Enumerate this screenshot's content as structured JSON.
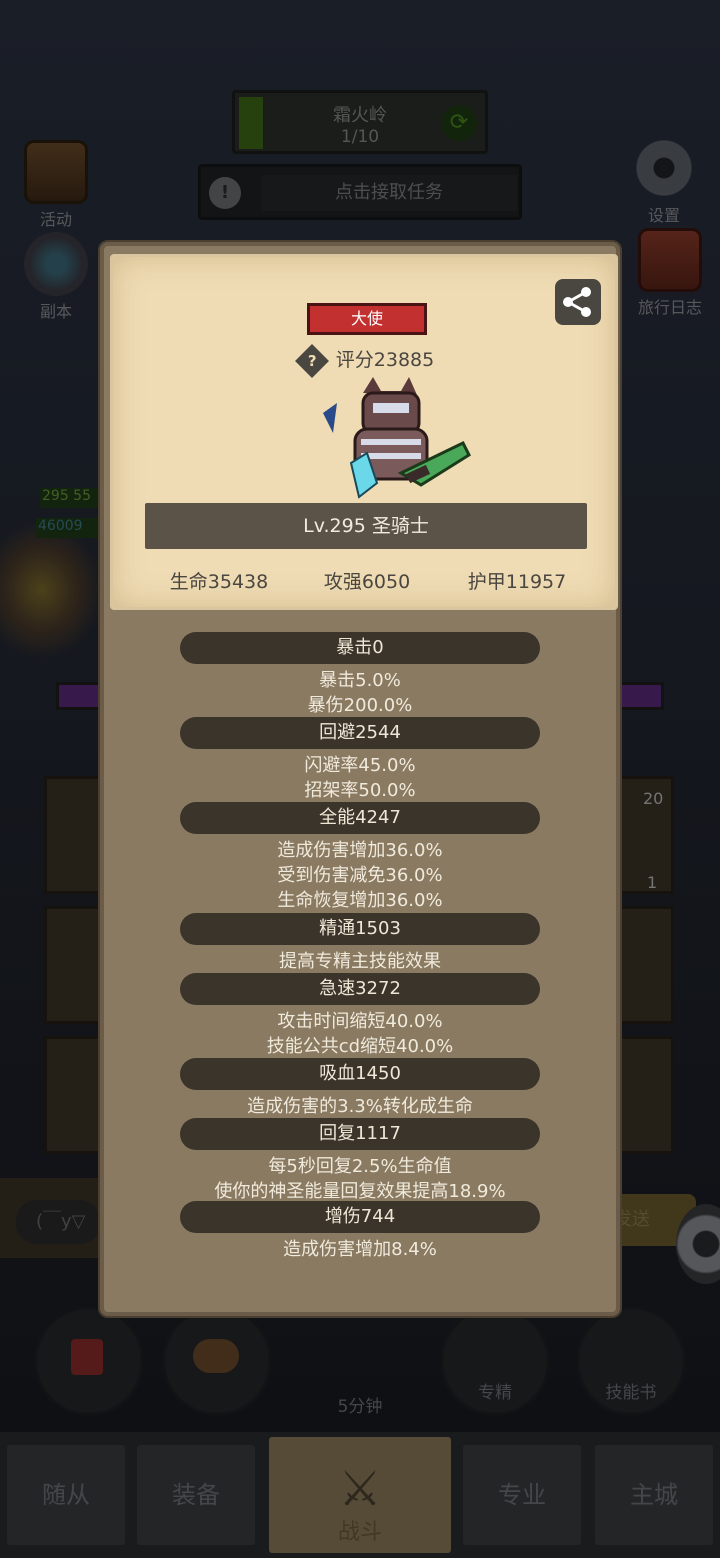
{
  "stage": {
    "name": "霜火岭",
    "count": "1/10"
  },
  "quest": {
    "text": "点击接取任务"
  },
  "side_buttons": {
    "activity": "活动",
    "dungeon": "副本",
    "settings": "设置",
    "journal": "旅行日志"
  },
  "battle": {
    "hp_a": "295 55",
    "hp_b": "46009"
  },
  "chat": {
    "input": "(￣y▽",
    "send": "发送"
  },
  "slots": {
    "badge_top": "20",
    "badge_bottom": "1"
  },
  "bottom_actions": {
    "chest_timer": "5分钟",
    "specialize": "专精",
    "skill_book": "技能书"
  },
  "tabs": [
    "随从",
    "装备",
    "战斗",
    "专业",
    "主城"
  ],
  "hero_card": {
    "rank": "大使",
    "score": "评分23885",
    "level_class": "Lv.295 圣骑士",
    "stats": {
      "hp": "生命35438",
      "attack": "攻强6050",
      "armor": "护甲11957"
    }
  },
  "secondary_stats": [
    {
      "title": "暴击0",
      "lines": [
        "暴击5.0%",
        "暴伤200.0%"
      ]
    },
    {
      "title": "回避2544",
      "lines": [
        "闪避率45.0%",
        "招架率50.0%"
      ]
    },
    {
      "title": "全能4247",
      "lines": [
        "造成伤害增加36.0%",
        "受到伤害减免36.0%",
        "生命恢复增加36.0%"
      ]
    },
    {
      "title": "精通1503",
      "lines": [
        "提高专精主技能效果"
      ]
    },
    {
      "title": "急速3272",
      "lines": [
        "攻击时间缩短40.0%",
        "技能公共cd缩短40.0%"
      ]
    },
    {
      "title": "吸血1450",
      "lines": [
        "造成伤害的3.3%转化成生命"
      ]
    },
    {
      "title": "回复1117",
      "lines": [
        "每5秒回复2.5%生命值",
        "使你的神圣能量回复效果提高18.9%"
      ]
    },
    {
      "title": "增伤744",
      "lines": [
        "造成伤害增加8.4%"
      ]
    }
  ]
}
